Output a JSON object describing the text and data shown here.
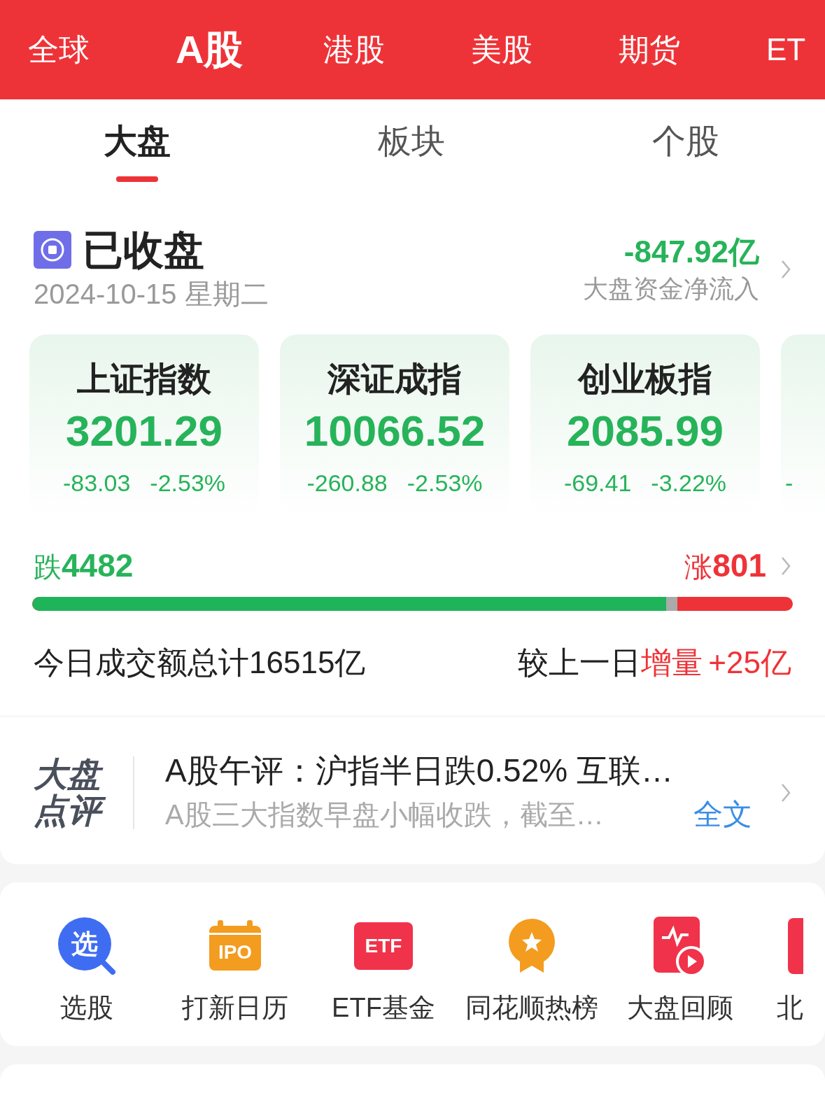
{
  "market_tabs": [
    {
      "label": "全球",
      "selected": false
    },
    {
      "label": "A股",
      "selected": true
    },
    {
      "label": "港股",
      "selected": false
    },
    {
      "label": "美股",
      "selected": false
    },
    {
      "label": "期货",
      "selected": false
    },
    {
      "label": "ET",
      "selected": false
    }
  ],
  "sub_tabs": [
    {
      "label": "大盘",
      "selected": true
    },
    {
      "label": "板块",
      "selected": false
    },
    {
      "label": "个股",
      "selected": false
    }
  ],
  "status": {
    "title": "已收盘",
    "date": "2024-10-15 星期二",
    "net_flow": "-847.92亿",
    "net_flow_label": "大盘资金净流入"
  },
  "indices": [
    {
      "name": "上证指数",
      "value": "3201.29",
      "change": "-83.03",
      "percent": "-2.53%"
    },
    {
      "name": "深证成指",
      "value": "10066.52",
      "change": "-260.88",
      "percent": "-2.53%"
    },
    {
      "name": "创业板指",
      "value": "2085.99",
      "change": "-69.41",
      "percent": "-3.22%"
    },
    {
      "change": "-"
    }
  ],
  "breadth": {
    "fall_label": "跌",
    "fall_count": "4482",
    "rise_label": "涨",
    "rise_count": "801",
    "fall_bar": {
      "level": 0.848
    }
  },
  "turnover": {
    "total": "今日成交额总计16515亿",
    "compare_label": "较上一日",
    "change_label": "增量",
    "change": "+25亿"
  },
  "commentary": {
    "logo_top": "大盘",
    "logo_bottom": "点评",
    "headline": "A股午评：沪指半日跌0.52% 互联…",
    "summary": "A股三大指数早盘小幅收跌，截至…",
    "link": "全文"
  },
  "shortcuts": [
    {
      "kind": "pick",
      "icon_text": "选",
      "label": "选股"
    },
    {
      "kind": "ipo",
      "icon_text": "IPO",
      "label": "打新日历"
    },
    {
      "kind": "etf",
      "icon_text": "ETF",
      "label": "ETF基金"
    },
    {
      "kind": "medal",
      "label": "同花顺热榜"
    },
    {
      "kind": "replay",
      "label": "大盘回顾"
    },
    {
      "kind": "cut",
      "label": "北"
    }
  ]
}
